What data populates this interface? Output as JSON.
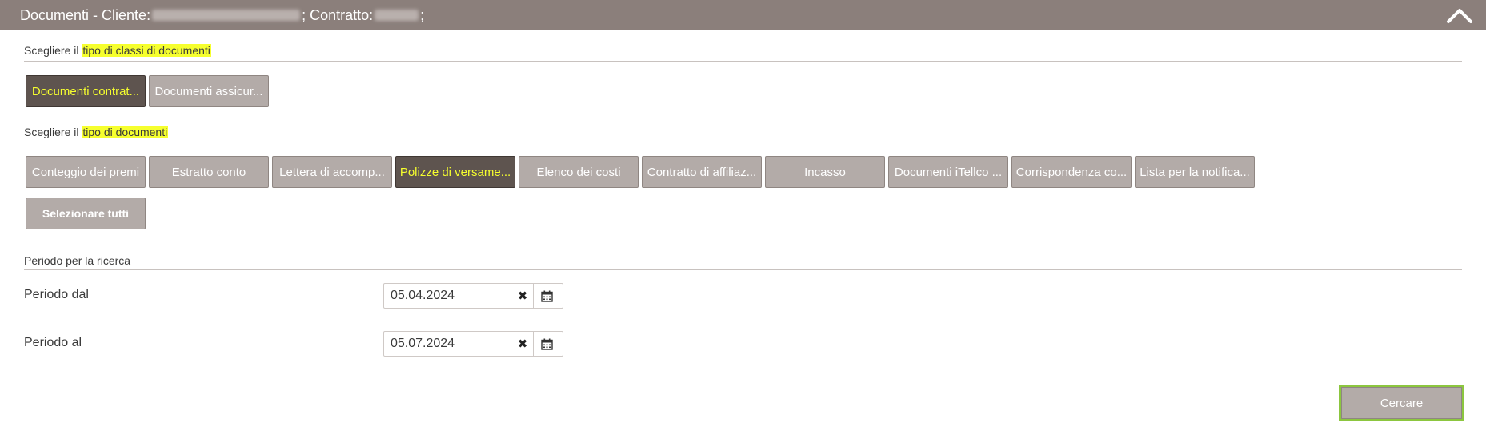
{
  "header": {
    "title_prefix": "Documenti - Cliente:",
    "contract_prefix": "; Contratto:",
    "suffix": ";"
  },
  "class_section": {
    "label_prefix": "Scegliere il",
    "label_highlight": "tipo di classi di documenti",
    "buttons": [
      {
        "label": "Documenti contrat...",
        "active": true
      },
      {
        "label": "Documenti assicur...",
        "active": false
      }
    ]
  },
  "type_section": {
    "label_prefix": "Scegliere il",
    "label_highlight": "tipo di documenti",
    "buttons": [
      {
        "label": "Conteggio dei premi",
        "active": false
      },
      {
        "label": "Estratto conto",
        "active": false
      },
      {
        "label": "Lettera di accomp...",
        "active": false
      },
      {
        "label": "Polizze di versame...",
        "active": true
      },
      {
        "label": "Elenco dei costi",
        "active": false
      },
      {
        "label": "Contratto di affiliaz...",
        "active": false
      },
      {
        "label": "Incasso",
        "active": false
      },
      {
        "label": "Documenti iTellco ...",
        "active": false
      },
      {
        "label": "Corrispondenza co...",
        "active": false
      },
      {
        "label": "Lista per la notifica...",
        "active": false
      }
    ],
    "select_all_label": "Selezionare tutti"
  },
  "period_section": {
    "label": "Periodo per la ricerca",
    "from_label": "Periodo dal",
    "from_value": "05.04.2024",
    "to_label": "Periodo al",
    "to_value": "05.07.2024"
  },
  "search_label": "Cercare",
  "colors": {
    "header_bg": "#8b7f7b",
    "button_bg": "#b3aba8",
    "active_bg": "#5e544f",
    "highlight": "#f6ff2e",
    "focus_border": "#8cc63f"
  },
  "icons": {
    "collapse": "chevron-up-icon",
    "clear": "clear-x-icon",
    "calendar": "calendar-icon"
  }
}
